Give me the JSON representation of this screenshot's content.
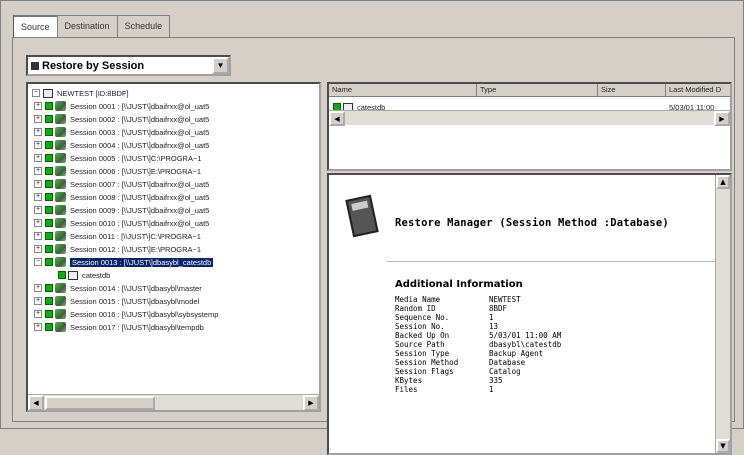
{
  "tabs": [
    {
      "label": "Source"
    },
    {
      "label": "Destination"
    },
    {
      "label": "Schedule"
    }
  ],
  "view_selector": {
    "selected": "Restore by Session"
  },
  "tree": {
    "root_label": "NEWTEST [ID:8BDF]",
    "sessions": [
      {
        "label": "Session 0001 : [\\\\JUST\\]dbaifrxx@ol_uat5"
      },
      {
        "label": "Session 0002 : [\\\\JUST\\]dbaifrxx@ol_uat5"
      },
      {
        "label": "Session 0003 : [\\\\JUST\\]dbaifrxx@ol_uat5"
      },
      {
        "label": "Session 0004 : [\\\\JUST\\]dbaifrxx@ol_uat5"
      },
      {
        "label": "Session 0005 : [\\\\JUST\\]C:\\PROGRA~1"
      },
      {
        "label": "Session 0006 : [\\\\JUST\\]E:\\PROGRA~1"
      },
      {
        "label": "Session 0007 : [\\\\JUST\\]dbaifrxx@ol_uat5"
      },
      {
        "label": "Session 0008 : [\\\\JUST\\]dbaifrxx@ol_uat5"
      },
      {
        "label": "Session 0009 : [\\\\JUST\\]dbaifrxx@ol_uat5"
      },
      {
        "label": "Session 0010 : [\\\\JUST\\]dbaifrxx@ol_uat5"
      },
      {
        "label": "Session 0011 : [\\\\JUST\\]C:\\PROGRA~1"
      },
      {
        "label": "Session 0012 : [\\\\JUST\\]E:\\PROGRA~1"
      },
      {
        "label": "Session 0013 : [\\\\JUST\\]dbasybl_catestdb"
      },
      {
        "label": "catestdb"
      },
      {
        "label": "Session 0014 : [\\\\JUST\\]dbasybl\\master"
      },
      {
        "label": "Session 0015 : [\\\\JUST\\]dbasybl\\model"
      },
      {
        "label": "Session 0016 : [\\\\JUST\\]dbasybl\\sybsystemp"
      },
      {
        "label": "Session 0017 : [\\\\JUST\\]dbasybl\\tempdb"
      }
    ]
  },
  "list": {
    "columns": [
      "Name",
      "Type",
      "Size",
      "Last Modified D"
    ],
    "row": {
      "name": "catestdb",
      "modified": "5/03/01 11:00"
    }
  },
  "info": {
    "title": "Restore Manager (Session Method :Database)",
    "section": "Additional Information",
    "fields": [
      {
        "key": "Media Name",
        "value": "NEWTEST"
      },
      {
        "key": "Random ID",
        "value": "8BDF"
      },
      {
        "key": "Sequence No.",
        "value": "1"
      },
      {
        "key": "Session No.",
        "value": "13"
      },
      {
        "key": "Backed Up On",
        "value": "5/03/01 11:00 AM"
      },
      {
        "key": "Source Path",
        "value": "dbasybl\\catestdb"
      },
      {
        "key": "Session Type",
        "value": "Backup Agent"
      },
      {
        "key": "Session Method",
        "value": "Database"
      },
      {
        "key": "Session Flags",
        "value": "Catalog"
      },
      {
        "key": "KBytes",
        "value": "335"
      },
      {
        "key": "Files",
        "value": "1"
      }
    ]
  }
}
